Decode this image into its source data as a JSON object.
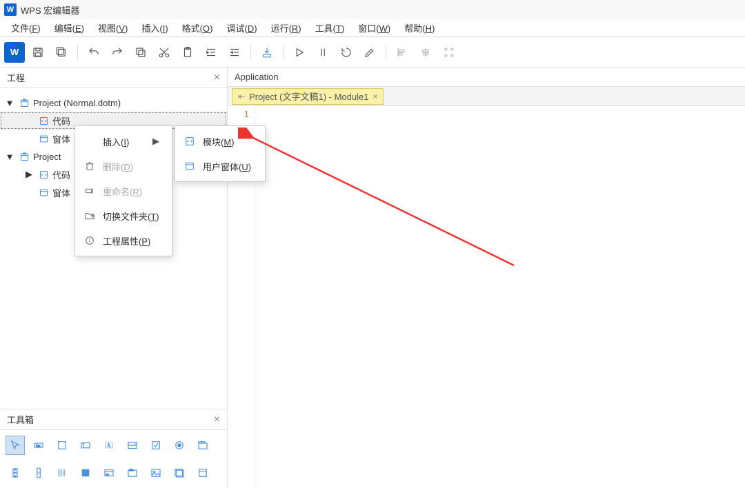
{
  "titlebar": {
    "title": "WPS 宏编辑器"
  },
  "menubar": [
    {
      "label": "文件",
      "hk": "F"
    },
    {
      "label": "编辑",
      "hk": "E"
    },
    {
      "label": "视图",
      "hk": "V"
    },
    {
      "label": "插入",
      "hk": "I"
    },
    {
      "label": "格式",
      "hk": "O"
    },
    {
      "label": "调试",
      "hk": "D"
    },
    {
      "label": "运行",
      "hk": "R"
    },
    {
      "label": "工具",
      "hk": "T"
    },
    {
      "label": "窗口",
      "hk": "W"
    },
    {
      "label": "帮助",
      "hk": "H"
    }
  ],
  "panels": {
    "project": {
      "title": "工程"
    },
    "toolbox": {
      "title": "工具箱"
    }
  },
  "tree": [
    {
      "indent": 0,
      "twist": "▼",
      "icon": "proj",
      "label": "Project (Normal.dotm)"
    },
    {
      "indent": 1,
      "twist": "",
      "icon": "code",
      "label": "代码",
      "selected": true
    },
    {
      "indent": 1,
      "twist": "",
      "icon": "form",
      "label": "窗体"
    },
    {
      "indent": 0,
      "twist": "▼",
      "icon": "proj",
      "label": "Project"
    },
    {
      "indent": 1,
      "twist": "▶",
      "icon": "code",
      "label": "代码"
    },
    {
      "indent": 1,
      "twist": "",
      "icon": "form",
      "label": "窗体"
    }
  ],
  "objectbox": {
    "value": "Application"
  },
  "tab": {
    "label": "Project (文字文稿1) - Module1"
  },
  "gutter": {
    "line1": "1"
  },
  "context_menu": [
    {
      "icon": "",
      "label": "插入",
      "hk": "I",
      "arrow": true,
      "disabled": false
    },
    {
      "icon": "trash",
      "label": "删除",
      "hk": "D",
      "disabled": true
    },
    {
      "icon": "rename",
      "label": "重命名",
      "hk": "R",
      "disabled": true
    },
    {
      "icon": "folder",
      "label": "切换文件夹",
      "hk": "T",
      "disabled": false
    },
    {
      "icon": "info",
      "label": "工程属性",
      "hk": "P",
      "disabled": false
    }
  ],
  "submenu": [
    {
      "icon": "code",
      "label": "模块",
      "hk": "M"
    },
    {
      "icon": "form",
      "label": "用户窗体",
      "hk": "U"
    }
  ],
  "toolbox_items": [
    "pointer",
    "button",
    "frame",
    "textbox",
    "label",
    "combo",
    "checkbox",
    "option",
    "tabstrip",
    "spin",
    "scroll",
    "lines",
    "block",
    "multi",
    "group",
    "image",
    "multipage",
    "toggle"
  ]
}
